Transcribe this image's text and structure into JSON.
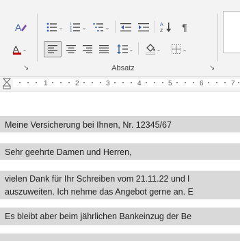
{
  "ribbon": {
    "group_label": "Absatz",
    "launcher_glyph": "↘",
    "font_color_letter": "A",
    "styles_letter": "A",
    "sort_label": "A\nZ",
    "pilcrow": "¶",
    "dropdown_glyph": "⌄"
  },
  "ruler": {
    "numbers": [
      "1",
      "2",
      "3",
      "4",
      "5",
      "6",
      "7"
    ]
  },
  "document": {
    "lines": [
      "Meine Versicherung bei Ihnen, Nr. 12345/67",
      "Sehr geehrte Damen und Herren,",
      "vielen Dank für Ihr Schreiben vom 21.11.22 und l",
      "auszuweiten. Ich nehme das Angebot gerne an. E",
      "Es bleibt aber beim jährlichen Bankeinzug der Be"
    ]
  },
  "colors": {
    "font_color_underline": "#c00000",
    "highlight": "#d9d9d9",
    "accent_purple": "#7a4fa3"
  }
}
